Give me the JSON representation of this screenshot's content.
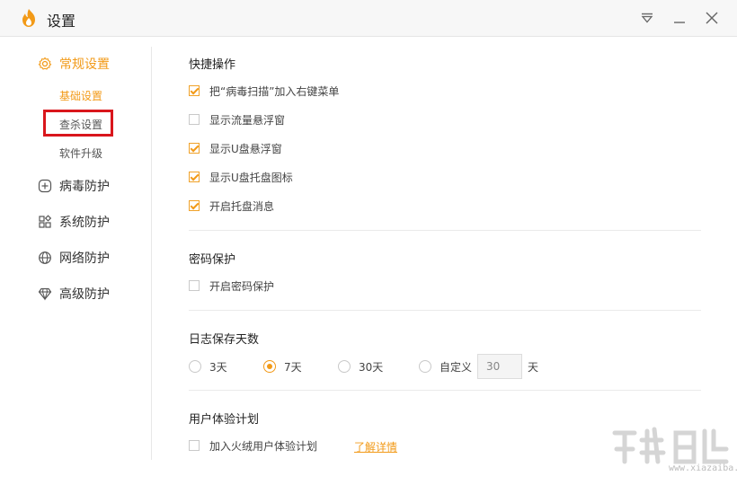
{
  "window": {
    "title": "设置",
    "controls": {
      "menu_icon": "dropdown-menu-icon",
      "minimize_icon": "minimize-icon",
      "close_icon": "close-icon"
    }
  },
  "colors": {
    "accent": "#f29a18",
    "highlight_border": "#d9161c",
    "text": "#333333",
    "divider": "#eaeaea"
  },
  "sidebar": {
    "general": {
      "label": "常规设置",
      "icon": "gear-icon"
    },
    "sub_items": [
      {
        "label": "基础设置"
      },
      {
        "label": "查杀设置"
      },
      {
        "label": "软件升级"
      }
    ],
    "items": [
      {
        "label": "病毒防护",
        "icon": "plus-circle-icon"
      },
      {
        "label": "系统防护",
        "icon": "grid-icon"
      },
      {
        "label": "网络防护",
        "icon": "globe-icon"
      },
      {
        "label": "高级防护",
        "icon": "diamond-icon"
      }
    ]
  },
  "quick_ops": {
    "title": "快捷操作",
    "options": [
      {
        "label": "把“病毒扫描”加入右键菜单"
      },
      {
        "label": "显示流量悬浮窗"
      },
      {
        "label": "显示U盘悬浮窗"
      },
      {
        "label": "显示U盘托盘图标"
      },
      {
        "label": "开启托盘消息"
      }
    ]
  },
  "password": {
    "title": "密码保护",
    "option": {
      "label": "开启密码保护"
    }
  },
  "log_days": {
    "title": "日志保存天数",
    "options": [
      {
        "label": "3天"
      },
      {
        "label": "7天"
      },
      {
        "label": "30天"
      },
      {
        "label": "自定义"
      }
    ],
    "custom_value": "30",
    "unit": "天"
  },
  "experience": {
    "title": "用户体验计划",
    "option": {
      "label": "加入火绒用户体验计划"
    },
    "link": "了解详情"
  },
  "watermark": {
    "text": "www.xiazaiba.com"
  }
}
